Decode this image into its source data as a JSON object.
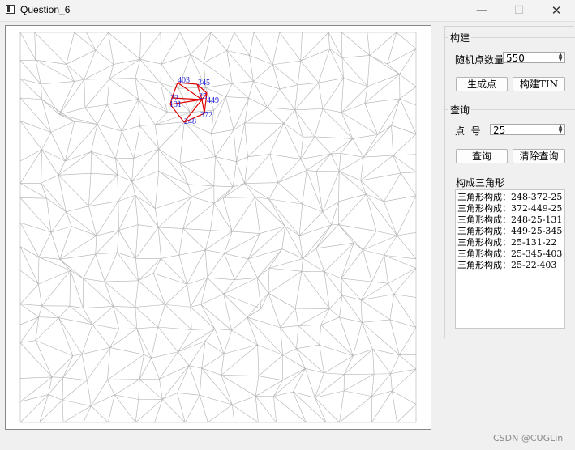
{
  "window": {
    "title": "Question_6",
    "minimize_glyph": "—",
    "maximize_glyph": "☐",
    "close_glyph": "✕"
  },
  "build": {
    "title": "构建",
    "count_label": "随机点数量",
    "count_value": "550",
    "generate_label": "生成点",
    "build_tin_label": "构建TIN"
  },
  "query": {
    "title": "查询",
    "point_label": "点  号",
    "point_value": "25",
    "query_label": "查询",
    "clear_label": "清除查询"
  },
  "results": {
    "title": "构成三角形",
    "items": [
      "三角形构成：248-372-25",
      "三角形构成：372-449-25",
      "三角形构成：248-25-131",
      "三角形构成：449-25-345",
      "三角形构成：25-131-22",
      "三角形构成：25-345-403",
      "三角形构成：25-22-403"
    ]
  },
  "tin": {
    "mesh_color": "#b0b0b0",
    "highlight_color": "#e00000",
    "label_color": "#1a1ad6",
    "center_point": "25",
    "neighbor_points": [
      "403",
      "345",
      "449",
      "372",
      "248",
      "131",
      "22"
    ]
  },
  "watermark": "CSDN @CUGLin"
}
